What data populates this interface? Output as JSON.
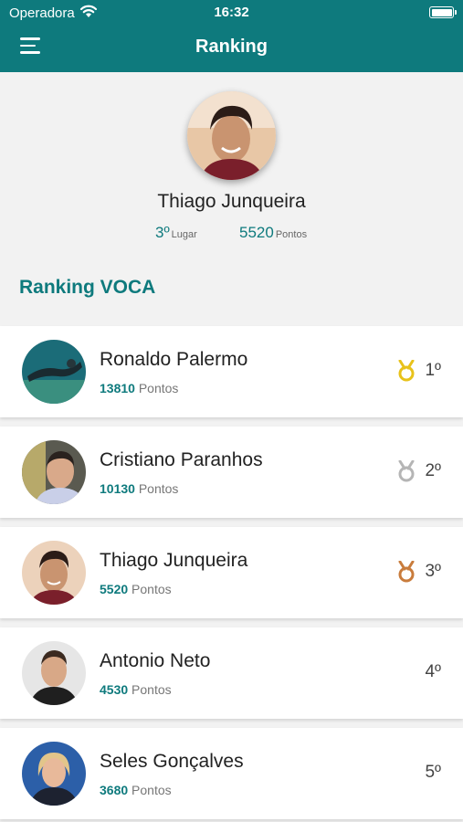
{
  "status_bar": {
    "carrier": "Operadora",
    "time": "16:32"
  },
  "header": {
    "title": "Ranking"
  },
  "profile": {
    "name": "Thiago Junqueira",
    "place": "3º",
    "place_label": "Lugar",
    "points": "5520",
    "points_label": "Pontos"
  },
  "section": {
    "title": "Ranking VOCA"
  },
  "ranking": [
    {
      "name": "Ronaldo Palermo",
      "points": "13810",
      "points_label": "Pontos",
      "place": "1º",
      "medal": "gold-medal-icon",
      "medal_color": "#e8c21a"
    },
    {
      "name": "Cristiano Paranhos",
      "points": "10130",
      "points_label": "Pontos",
      "place": "2º",
      "medal": "silver-medal-icon",
      "medal_color": "#b5b5b5"
    },
    {
      "name": "Thiago Junqueira",
      "points": "5520",
      "points_label": "Pontos",
      "place": "3º",
      "medal": "bronze-medal-icon",
      "medal_color": "#c97c3c"
    },
    {
      "name": "Antonio Neto",
      "points": "4530",
      "points_label": "Pontos",
      "place": "4º"
    },
    {
      "name": "Seles Gonçalves",
      "points": "3680",
      "points_label": "Pontos",
      "place": "5º"
    }
  ],
  "colors": {
    "brand": "#0e7a7d",
    "background": "#f2f2f2"
  }
}
